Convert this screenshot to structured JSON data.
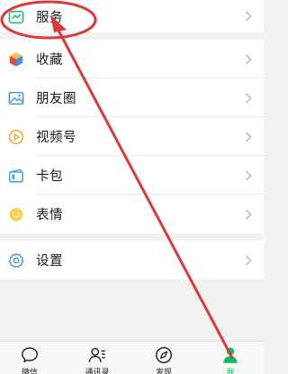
{
  "menu_top": {
    "items": [
      {
        "label": "服务",
        "icon": "service-icon"
      }
    ]
  },
  "menu_main": {
    "items": [
      {
        "label": "收藏",
        "icon": "favorites-cube-icon"
      },
      {
        "label": "朋友圈",
        "icon": "moments-picture-icon"
      },
      {
        "label": "视频号",
        "icon": "channels-play-icon"
      },
      {
        "label": "卡包",
        "icon": "card-wallet-icon"
      },
      {
        "label": "表情",
        "icon": "sticker-smile-icon"
      }
    ]
  },
  "menu_settings": {
    "items": [
      {
        "label": "设置",
        "icon": "gear-icon"
      }
    ]
  },
  "tabbar": {
    "tabs": [
      {
        "label": "微信",
        "icon": "chat-bubble-icon"
      },
      {
        "label": "通讯录",
        "icon": "contacts-icon"
      },
      {
        "label": "发现",
        "icon": "compass-icon"
      },
      {
        "label": "我",
        "icon": "person-icon",
        "active": true
      }
    ]
  },
  "colors": {
    "accent_green": "#07c160",
    "annotation_red": "#d93a3a",
    "icon_orange": "#f0a830",
    "icon_blue": "#3f8ee8"
  }
}
